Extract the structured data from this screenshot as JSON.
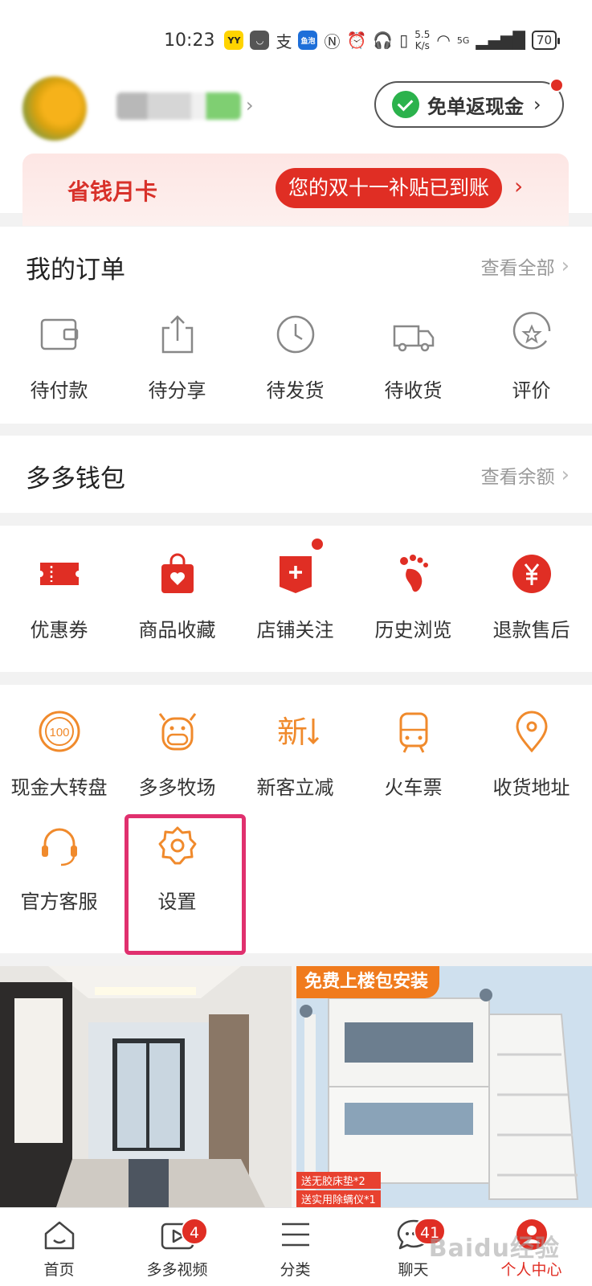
{
  "status_bar": {
    "time": "10:23",
    "app_icons": [
      "YY",
      "支",
      "鱼泡"
    ],
    "net_speed_value": "5.5",
    "net_speed_unit": "K/s",
    "signal": "5G",
    "battery": "70"
  },
  "profile": {
    "cashback_label": "免单返现金"
  },
  "month_card": {
    "title": "省钱月卡",
    "subsidy_text": "您的双十一补贴已到账"
  },
  "orders": {
    "title": "我的订单",
    "view_all": "查看全部",
    "items": [
      {
        "label": "待付款",
        "icon": "wallet-icon"
      },
      {
        "label": "待分享",
        "icon": "share-icon"
      },
      {
        "label": "待发货",
        "icon": "clock-icon"
      },
      {
        "label": "待收货",
        "icon": "truck-icon"
      },
      {
        "label": "评价",
        "icon": "star-review-icon"
      }
    ]
  },
  "wallet": {
    "title": "多多钱包",
    "view_balance": "查看余额"
  },
  "features": {
    "items": [
      {
        "label": "优惠券",
        "icon": "coupon-icon"
      },
      {
        "label": "商品收藏",
        "icon": "favorites-bag-icon"
      },
      {
        "label": "店铺关注",
        "icon": "store-follow-icon"
      },
      {
        "label": "历史浏览",
        "icon": "footprint-icon"
      },
      {
        "label": "退款售后",
        "icon": "refund-yen-icon"
      }
    ]
  },
  "services": {
    "items": [
      {
        "label": "现金大转盘",
        "icon": "cash-wheel-icon"
      },
      {
        "label": "多多牧场",
        "icon": "cow-icon"
      },
      {
        "label": "新客立减",
        "icon": "new-discount-icon",
        "glyph": "新"
      },
      {
        "label": "火车票",
        "icon": "train-icon"
      },
      {
        "label": "收货地址",
        "icon": "location-pin-icon"
      },
      {
        "label": "官方客服",
        "icon": "headset-icon"
      },
      {
        "label": "设置",
        "icon": "gear-icon"
      }
    ]
  },
  "feed": {
    "right_banner": "免费上楼包安装",
    "right_tags": [
      "送无胶床垫*2",
      "送实用除螨仪*1"
    ]
  },
  "tabbar": {
    "items": [
      {
        "label": "首页",
        "icon": "home-icon"
      },
      {
        "label": "多多视频",
        "icon": "video-icon",
        "badge": "4"
      },
      {
        "label": "分类",
        "icon": "category-icon"
      },
      {
        "label": "聊天",
        "icon": "chat-icon",
        "badge": "41"
      },
      {
        "label": "个人中心",
        "icon": "profile-icon",
        "active": true
      }
    ]
  },
  "colors": {
    "brand_red": "#e02e24",
    "service_orange": "#f08a2c",
    "highlight_pink": "#e0306e",
    "wechat_green": "#2bb24c"
  },
  "watermark": "Baidu经验"
}
